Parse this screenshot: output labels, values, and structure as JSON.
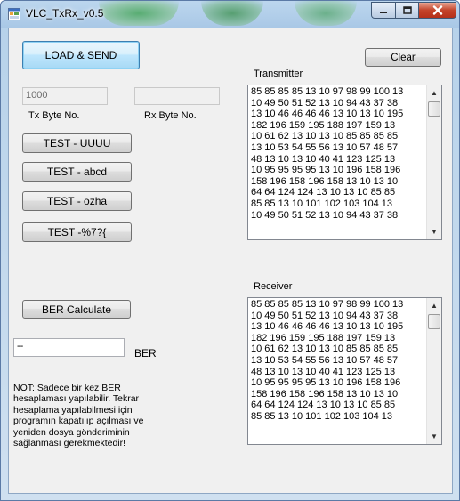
{
  "window": {
    "title": "VLC_TxRx_v0.5",
    "controls": {
      "minimize": "–",
      "maximize": "□",
      "close": "✕"
    }
  },
  "buttons": {
    "load_send": "LOAD & SEND",
    "clear": "Clear",
    "test_uuuu": "TEST - UUUU",
    "test_abcd": "TEST - abcd",
    "test_ozha": "TEST - ozha",
    "test_symbols": "TEST -%7?{",
    "ber_calculate": "BER Calculate"
  },
  "fields": {
    "tx_byte_value": "1000",
    "rx_byte_value": "",
    "ber_value": "--"
  },
  "labels": {
    "tx_byte_no": "Tx Byte No.",
    "rx_byte_no": "Rx Byte No.",
    "transmitter": "Transmitter",
    "receiver": "Receiver",
    "ber": "BER"
  },
  "note": "NOT: Sadece bir kez BER hesaplaması yapılabilir. Tekrar hesaplama yapılabilmesi için programın kapatılıp açılması ve yeniden dosya gönderiminin sağlanması gerekmektedir!",
  "transmitter_text": "85 85 85 85 13 10 97 98 99 100 13\n10 49 50 51 52 13 10 94 43 37 38\n13 10 46 46 46 46 13 10 13 10 195\n182 196 159 195 188 197 159 13\n10 61 62 13 10 13 10 85 85 85 85\n13 10 53 54 55 56 13 10 57 48 57\n48 13 10 13 10 40 41 123 125 13\n10 95 95 95 95 13 10 196 158 196\n158 196 158 196 158 13 10 13 10\n64 64 124 124 13 10 13 10 85 85\n85 85 13 10 101 102 103 104 13\n10 49 50 51 52 13 10 94 43 37 38",
  "receiver_text": "85 85 85 85 13 10 97 98 99 100 13\n10 49 50 51 52 13 10 94 43 37 38\n13 10 46 46 46 46 13 10 13 10 195\n182 196 159 195 188 197 159 13\n10 61 62 13 10 13 10 85 85 85 85\n13 10 53 54 55 56 13 10 57 48 57\n48 13 10 13 10 40 41 123 125 13\n10 95 95 95 95 13 10 196 158 196\n158 196 158 196 158 13 10 13 10\n64 64 124 124 13 10 13 10 85 85\n85 85 13 10 101 102 103 104 13",
  "scroll": {
    "up": "▲",
    "down": "▼"
  },
  "colors": {
    "title_bar": "#a9c8e6",
    "close_button": "#c4432a",
    "client_bg": "#f0f0f0"
  }
}
